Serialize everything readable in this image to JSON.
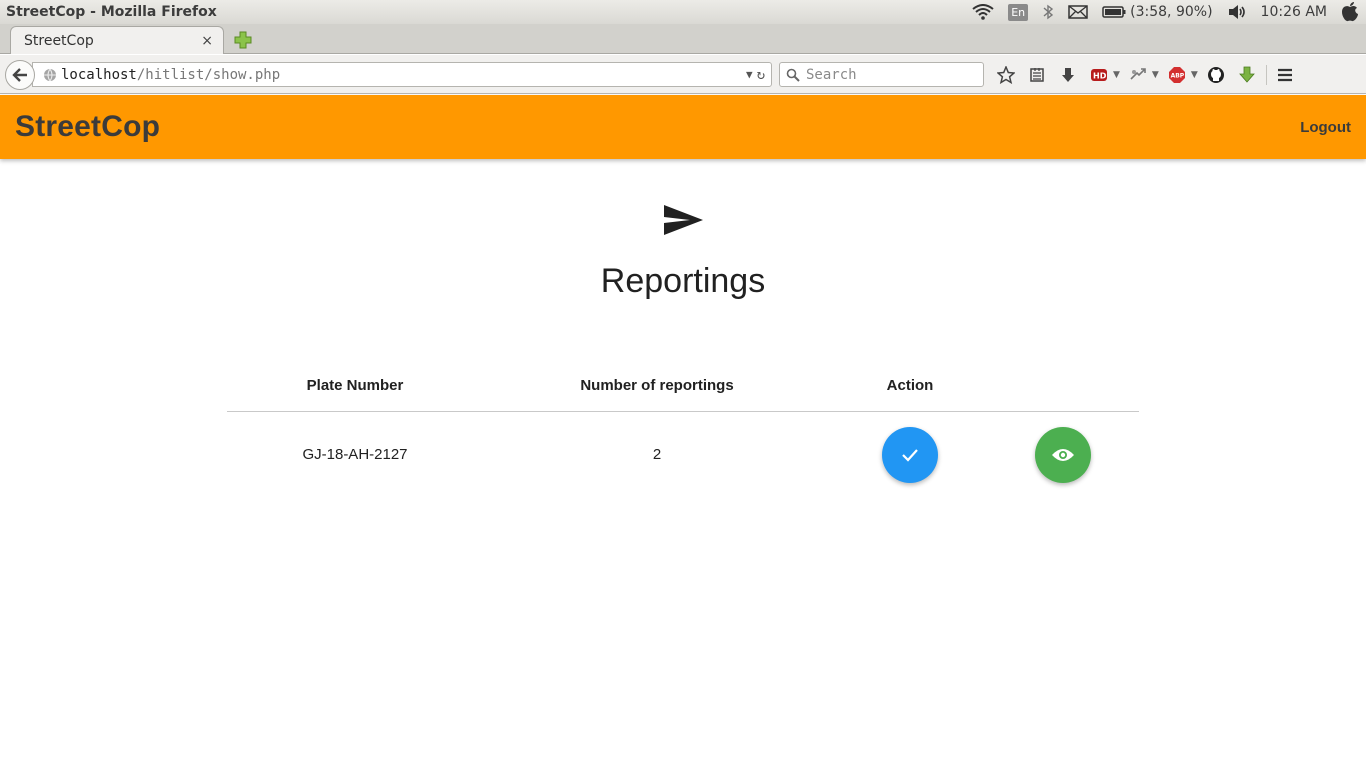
{
  "os": {
    "window_title": "StreetCop - Mozilla Firefox",
    "battery": "(3:58, 90%)",
    "clock": "10:26 AM",
    "keyboard_layout": "En"
  },
  "browser": {
    "tab_title": "StreetCop",
    "tab_close": "×",
    "url_host": "localhost",
    "url_path": "/hitlist/show.php",
    "search_placeholder": "Search",
    "toolbar_icons": [
      "star-icon",
      "reading-list-icon",
      "download-icon",
      "hd-icon",
      "extension-icon",
      "abp-icon",
      "github-icon",
      "download-helper-icon",
      "menu-icon"
    ]
  },
  "app": {
    "brand": "StreetCop",
    "logout_label": "Logout",
    "header_color": "#ff9800"
  },
  "page": {
    "title": "Reportings",
    "icon": "send-icon"
  },
  "table": {
    "columns": [
      "Plate Number",
      "Number of reportings",
      "Action"
    ],
    "rows": [
      {
        "plate": "GJ-18-AH-2127",
        "count": "2",
        "actions": [
          "check-icon",
          "eye-icon"
        ]
      }
    ]
  },
  "colors": {
    "approve_button": "#2196f3",
    "view_button": "#4caf50"
  }
}
